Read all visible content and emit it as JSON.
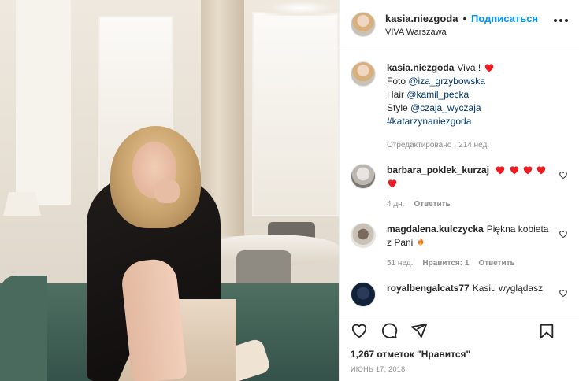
{
  "post": {
    "author": "kasia.niezgoda",
    "separator": "•",
    "follow_label": "Подписаться",
    "location": "VIVA Warszawa"
  },
  "caption": {
    "username": "kasia.niezgoda",
    "line1": "Viva !",
    "line2_prefix": "Foto ",
    "line2_mention": "@iza_grzybowska",
    "line3_prefix": "Hair ",
    "line3_mention": "@kamil_pecka",
    "line4_prefix": "Style ",
    "line4_mention": "@czaja_wyczaja",
    "line5_hashtag": "#katarzynaniezgoda",
    "edited": "Отредактировано · 214 нед."
  },
  "comments": [
    {
      "username": "barbara_poklek_kurzaj",
      "hearts": 5,
      "time": "4 дн.",
      "likes": "",
      "reply": "Ответить"
    },
    {
      "username": "magdalena.kulczycka",
      "text": "Piękna kobieta z Pani",
      "emoji": "fire",
      "time": "51 нед.",
      "likes": "Нравится: 1",
      "reply": "Ответить"
    },
    {
      "username": "royalbengalcats77",
      "text": "Kasiu wyglądasz",
      "time": "",
      "likes": "",
      "reply": ""
    }
  ],
  "footer": {
    "likes_count": "1,267 отметок \"Нравится\"",
    "date": "ИЮНЬ 17, 2018"
  },
  "colors": {
    "accent_blue": "#0095f6",
    "mention_blue": "#00376b",
    "heart_red": "#ed1c24",
    "muted": "#8e8e8e"
  },
  "icons": [
    "more-options-icon",
    "like-icon",
    "comment-icon",
    "share-icon",
    "save-icon",
    "comment-like-icon",
    "heart-emoji-icon",
    "fire-emoji-icon"
  ]
}
